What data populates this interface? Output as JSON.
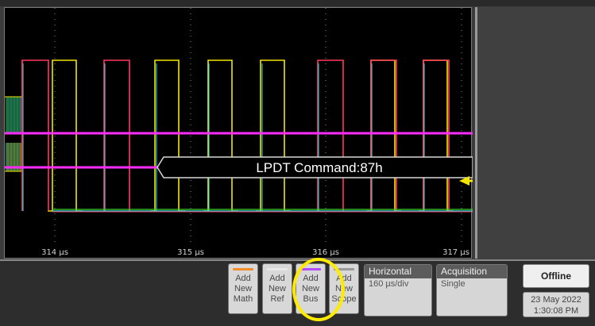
{
  "waveform": {
    "time_labels": [
      "314 µs",
      "315 µs",
      "316 µs",
      "317 µs"
    ],
    "bus_label": "LPDT Command:87h",
    "colors": {
      "yellow": "#f2e600",
      "red": "#ff3860",
      "magenta": "#ff2cff",
      "cyan": "#2fe0e8",
      "green": "#3bd12e",
      "orange": "#f28c28",
      "grid": "#8a8a8a"
    }
  },
  "buttons": [
    {
      "l1": "Add",
      "l2": "New",
      "l3": "Math",
      "color": "#f28c28"
    },
    {
      "l1": "Add",
      "l2": "New",
      "l3": "Ref",
      "color": "#e8e8e8"
    },
    {
      "l1": "Add",
      "l2": "New",
      "l3": "Bus",
      "color": "#b24cff"
    },
    {
      "l1": "Add",
      "l2": "New",
      "l3": "Scope",
      "color": "#9a9a9a"
    }
  ],
  "horizontal": {
    "header": "Horizontal",
    "value": "160 µs/div"
  },
  "acquisition": {
    "header": "Acquisition",
    "value": "Single"
  },
  "status": {
    "offline": "Offline",
    "date": "23 May 2022",
    "time": "1:30:08 PM"
  }
}
